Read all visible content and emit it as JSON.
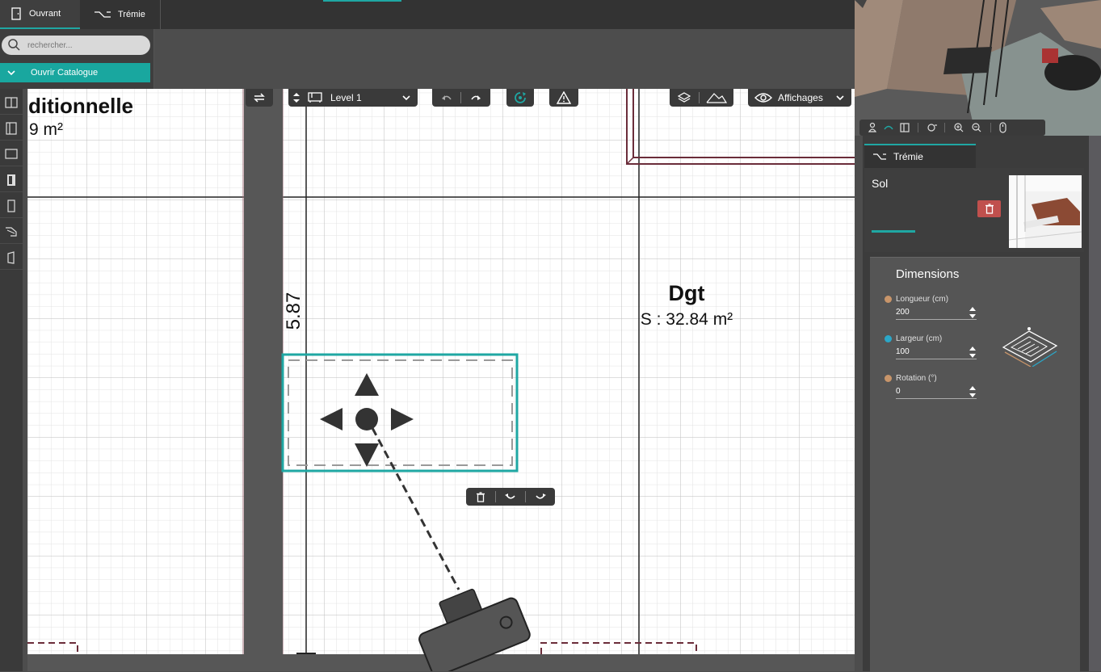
{
  "topbar": {
    "tabs": [
      {
        "label": "Ouvrant",
        "icon": "door-icon",
        "active": true
      },
      {
        "label": "Trémie",
        "icon": "stair-opening-icon",
        "active": false
      }
    ]
  },
  "search": {
    "placeholder": "rechercher..."
  },
  "catalog": {
    "label": "Ouvrir Catalogue"
  },
  "left_tools": [
    "wall-icon",
    "double-wall-icon",
    "room-icon",
    "door-icon",
    "window-icon",
    "stairs-icon",
    "panel-icon"
  ],
  "canvas_toolbar": {
    "level_label": "Level 1",
    "views_label": "Affichages"
  },
  "rooms": [
    {
      "name": "ditionnelle",
      "area": "9 m²"
    },
    {
      "name": "Dgt",
      "area": "S : 32.84 m²"
    }
  ],
  "dimension_label": "5.87",
  "right_panel": {
    "tab_label": "Trémie",
    "section_label": "Sol",
    "dimensions_title": "Dimensions",
    "fields": [
      {
        "label": "Longueur (cm)",
        "value": "200",
        "color": "#c8956a"
      },
      {
        "label": "Largeur (cm)",
        "value": "100",
        "color": "#2ba7c8"
      },
      {
        "label": "Rotation (°)",
        "value": "0",
        "color": "#c8956a"
      }
    ]
  },
  "colors": {
    "accent": "#1fa7a3",
    "delete": "#c0504d",
    "wall": "#6b2d3a"
  }
}
